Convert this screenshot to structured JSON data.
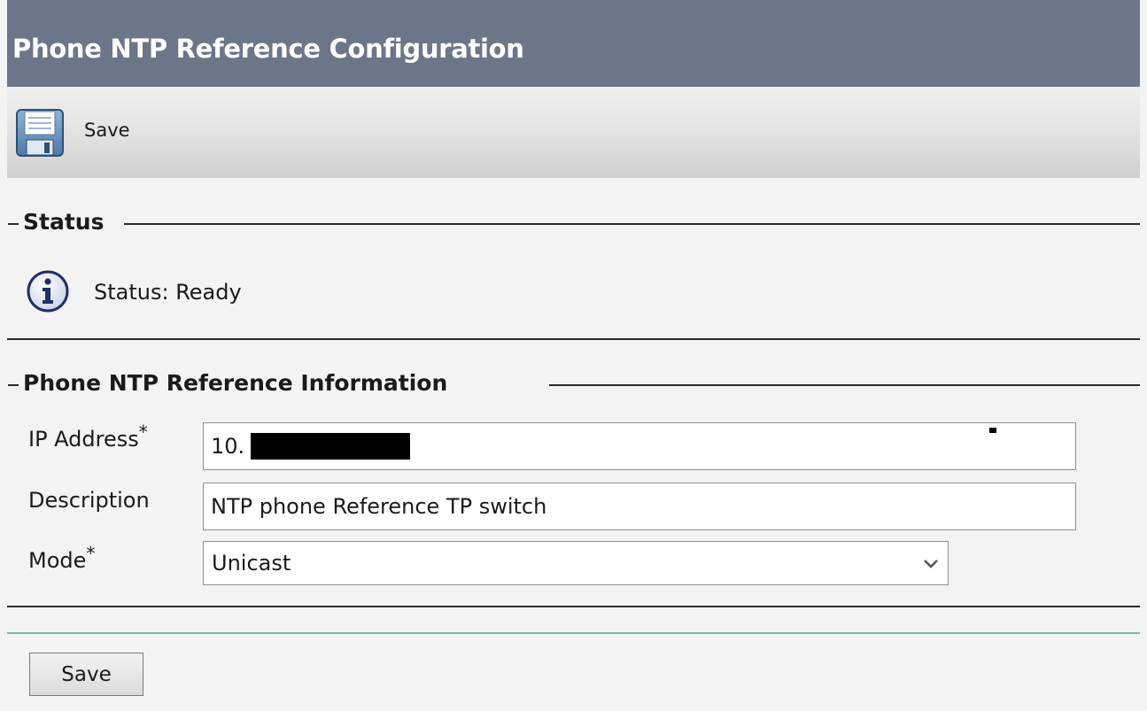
{
  "header": {
    "title": "Phone NTP Reference Configuration"
  },
  "toolbar": {
    "save_label": "Save",
    "save_icon": "floppy-disk-icon"
  },
  "status_section": {
    "legend": "Status",
    "icon": "info-icon",
    "message": "Status: Ready"
  },
  "info_section": {
    "legend": "Phone NTP Reference Information",
    "fields": {
      "ip_address": {
        "label": "IP Address",
        "required_mark": "*",
        "value": "10."
      },
      "description": {
        "label": "Description",
        "value": "NTP phone Reference TP switch"
      },
      "mode": {
        "label": "Mode",
        "required_mark": "*",
        "selected": "Unicast"
      }
    }
  },
  "footer": {
    "save_label": "Save"
  },
  "colors": {
    "title_bar": "#6b7689",
    "page_background": "#f3f3f3",
    "separator": "#7fb4ad"
  }
}
